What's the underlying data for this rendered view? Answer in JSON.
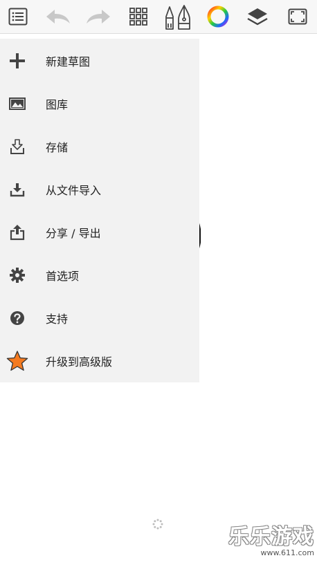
{
  "toolbar": {
    "icons": [
      "list-icon",
      "undo-icon",
      "redo-icon",
      "grid-icon",
      "brush-icon",
      "color-wheel-icon",
      "layers-icon",
      "fullscreen-icon"
    ]
  },
  "menu": {
    "items": [
      {
        "label": "新建草图",
        "icon": "plus-icon"
      },
      {
        "label": "图库",
        "icon": "gallery-icon"
      },
      {
        "label": "存储",
        "icon": "save-icon"
      },
      {
        "label": "从文件导入",
        "icon": "import-icon"
      },
      {
        "label": "分享 / 导出",
        "icon": "share-icon"
      },
      {
        "label": "首选项",
        "icon": "gear-icon"
      },
      {
        "label": "支持",
        "icon": "help-icon"
      },
      {
        "label": "升级到高级版",
        "icon": "star-icon"
      }
    ]
  },
  "watermark": {
    "title": "乐乐游戏",
    "url": "www.611.com"
  },
  "colors": {
    "accent_star": "#f47a20",
    "menu_bg": "#f2f2f2",
    "icon_dark": "#444444",
    "icon_disabled": "#c8c8c8"
  }
}
